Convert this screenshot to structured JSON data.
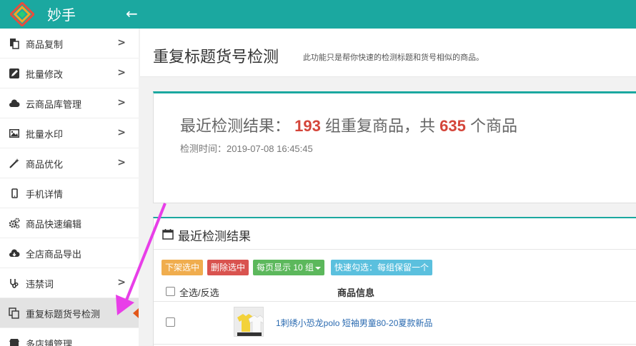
{
  "app": {
    "brand": "妙手",
    "back_icon": "arrow-left-icon",
    "colors": {
      "header": "#1ba8a0",
      "accent": "#1ba8a0",
      "highlight_num": "#d4453a",
      "link": "#2a6ab0",
      "annotation_arrow": "#e83ee8",
      "active_marker": "#e2571a"
    }
  },
  "sidebar": {
    "items": [
      {
        "label": "商品复制",
        "icon": "copy-doc-icon",
        "has_chevron": true
      },
      {
        "label": "批量修改",
        "icon": "edit-icon",
        "has_chevron": true
      },
      {
        "label": "云商品库管理",
        "icon": "cloud-icon",
        "has_chevron": true
      },
      {
        "label": "批量水印",
        "icon": "image-icon",
        "has_chevron": true
      },
      {
        "label": "商品优化",
        "icon": "magic-wand-icon",
        "has_chevron": true
      },
      {
        "label": "手机详情",
        "icon": "mobile-icon",
        "has_chevron": false
      },
      {
        "label": "商品快速编辑",
        "icon": "gears-icon",
        "has_chevron": false
      },
      {
        "label": "全店商品导出",
        "icon": "cloud-download-icon",
        "has_chevron": false
      },
      {
        "label": "违禁词",
        "icon": "stethoscope-icon",
        "has_chevron": true
      },
      {
        "label": "重复标题货号检测",
        "icon": "duplicate-icon",
        "has_chevron": false,
        "active": true
      },
      {
        "label": "多店铺管理",
        "icon": "store-icon",
        "has_chevron": false
      }
    ]
  },
  "header": {
    "title": "重复标题货号检测",
    "subtitle": "此功能只是帮你快速的检测标题和货号相似的商品。"
  },
  "summary": {
    "prefix": "最近检测结果：",
    "groups": "193",
    "middle": "组重复商品，共",
    "items": "635",
    "suffix": "个商品",
    "time_label": "检测时间：",
    "time_value": "2019-07-08 16:45:45"
  },
  "results": {
    "title": "最近检测结果",
    "buttons": {
      "off_shelf": "下架选中",
      "delete": "删除选中",
      "per_page": "每页显示 10 组",
      "quick_select": "快速勾选：每组保留一个"
    },
    "columns": {
      "select_all": "全选/反选",
      "info": "商品信息"
    },
    "rows": [
      {
        "title": "1刺绣小恐龙polo 短袖男童80-20夏款新品"
      }
    ]
  }
}
